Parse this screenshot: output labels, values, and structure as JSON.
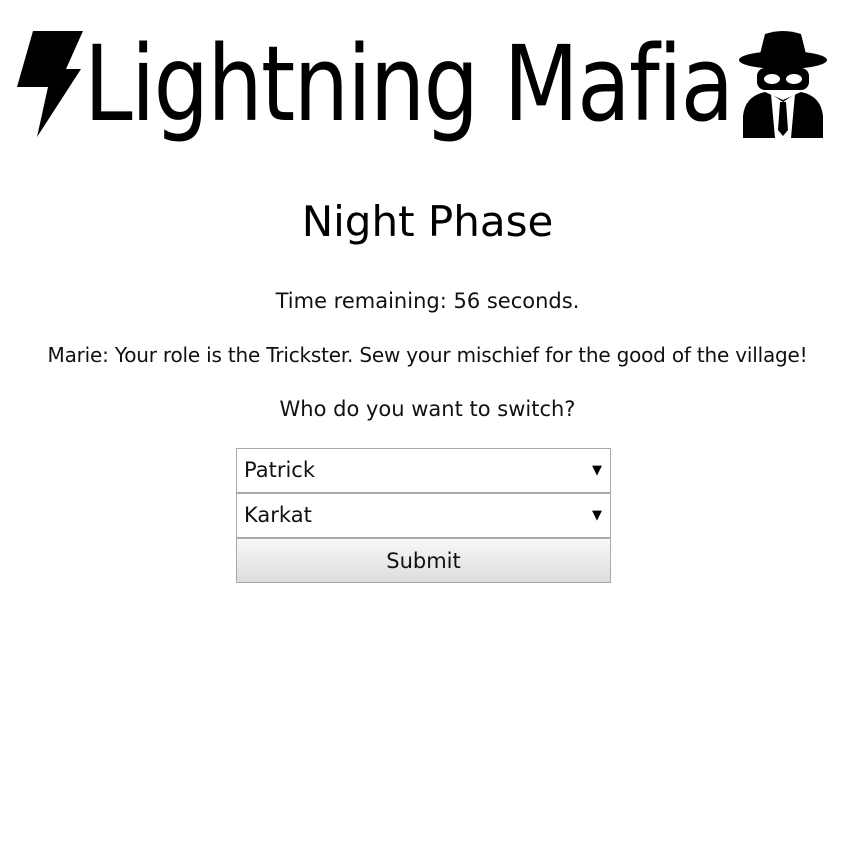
{
  "header": {
    "title": "Lightning Mafia",
    "left_icon": "lightning-bolt-icon",
    "right_icon": "spy-icon"
  },
  "phase": {
    "title": "Night Phase"
  },
  "timer": {
    "text": "Time remaining: 56 seconds."
  },
  "role_message": "Marie: Your role is the Trickster. Sew your mischief for the good of the village!",
  "prompt": "Who do you want to switch?",
  "form": {
    "first_select": {
      "selected": "Patrick",
      "arrow_icon": "dropdown-arrow-icon"
    },
    "second_select": {
      "selected": "Karkat",
      "arrow_icon": "dropdown-arrow-icon"
    },
    "submit_label": "Submit"
  },
  "colors": {
    "background": "#ffffff",
    "text": "#111111",
    "border": "#a9a9a9"
  }
}
